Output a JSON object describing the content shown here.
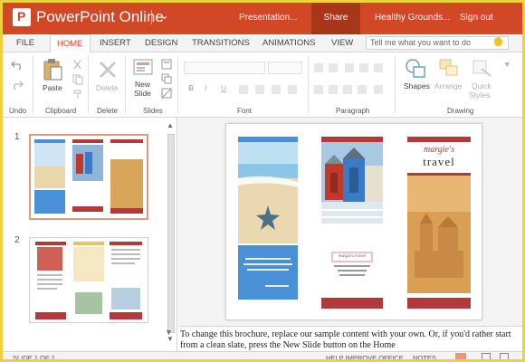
{
  "app": {
    "title": "PowerPoint Online",
    "document_name": "Presentation...",
    "share_label": "Share",
    "user_name": "Healthy Grounds...",
    "signout_label": "Sign out",
    "brand_color": "#d24726"
  },
  "tabs": [
    {
      "label": "FILE"
    },
    {
      "label": "HOME",
      "active": true
    },
    {
      "label": "INSERT"
    },
    {
      "label": "DESIGN"
    },
    {
      "label": "TRANSITIONS"
    },
    {
      "label": "ANIMATIONS"
    },
    {
      "label": "VIEW"
    }
  ],
  "tell_me": {
    "placeholder": "Tell me what you want to do"
  },
  "ribbon": {
    "groups": {
      "undo": "Undo",
      "clipboard": "Clipboard",
      "delete": "Delete",
      "slides": "Slides",
      "font": "Font",
      "paragraph": "Paragraph",
      "drawing": "Drawing"
    },
    "buttons": {
      "paste": "Paste",
      "delete": "Delete",
      "new_slide_1": "New",
      "new_slide_2": "Slide",
      "shapes": "Shapes",
      "arrange": "Arrange",
      "quick_styles_1": "Quick",
      "quick_styles_2": "Styles"
    }
  },
  "thumbnails": [
    {
      "number": "1",
      "selected": true
    },
    {
      "number": "2",
      "selected": false
    }
  ],
  "slide": {
    "brochure_title_1": "margie's",
    "brochure_title_2": "travel",
    "logo_text_1": "margie's travel",
    "accent_colors": {
      "blue": "#4a90d6",
      "red": "#b23a3a"
    }
  },
  "notes_text": "To change this brochure, replace our sample content with your own. Or, if you'd rather start from a clean slate, press the New Slide button on the Home",
  "status": {
    "slide_info": "SLIDE 1 OF 2",
    "help_improve": "HELP IMPROVE OFFICE",
    "notes_label": "NOTES"
  }
}
